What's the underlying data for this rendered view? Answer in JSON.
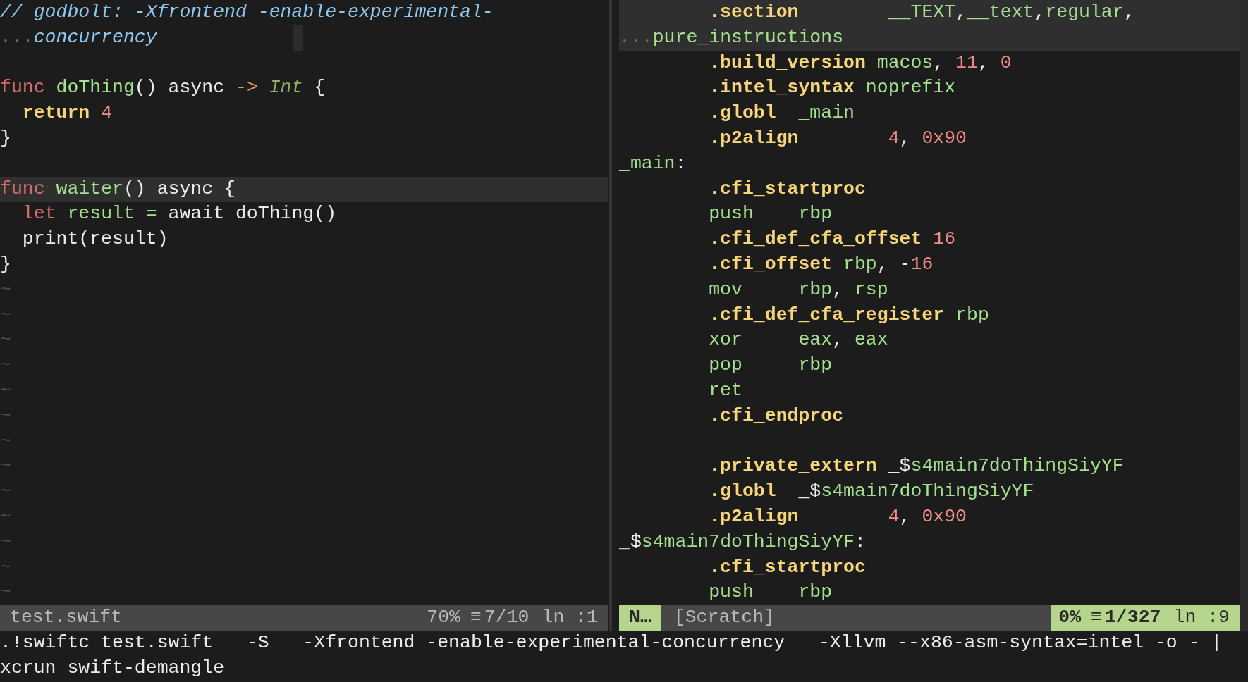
{
  "left_pane": {
    "lines": [
      {
        "kind": "code",
        "current": false,
        "tokens": [
          {
            "text": "// godbolt: -Xfrontend -enable-experimental-",
            "kind": "comment"
          }
        ]
      },
      {
        "kind": "code",
        "current": false,
        "cursor": true,
        "tokens": [
          {
            "text": "...",
            "kind": "wrap"
          },
          {
            "text": "concurrency",
            "kind": "comment"
          }
        ]
      },
      {
        "kind": "blank"
      },
      {
        "kind": "code",
        "current": false,
        "tokens": [
          {
            "text": "func",
            "kind": "keyword"
          },
          {
            "text": " doThing",
            "kind": "name"
          },
          {
            "text": "() async ",
            "kind": "plain"
          },
          {
            "text": "->",
            "kind": "operator"
          },
          {
            "text": " Int",
            "kind": "type"
          },
          {
            "text": " {",
            "kind": "plain"
          }
        ]
      },
      {
        "kind": "code",
        "current": false,
        "tokens": [
          {
            "text": "  return",
            "kind": "statement"
          },
          {
            "text": " 4",
            "kind": "number"
          }
        ]
      },
      {
        "kind": "code",
        "current": false,
        "tokens": [
          {
            "text": "}",
            "kind": "plain"
          }
        ]
      },
      {
        "kind": "blank"
      },
      {
        "kind": "code",
        "current": true,
        "tokens": [
          {
            "text": "func",
            "kind": "keyword"
          },
          {
            "text": " waiter",
            "kind": "name"
          },
          {
            "text": "() async {",
            "kind": "plain"
          }
        ]
      },
      {
        "kind": "code",
        "current": false,
        "tokens": [
          {
            "text": "  let",
            "kind": "keyword"
          },
          {
            "text": " result =",
            "kind": "name"
          },
          {
            "text": " await doThing()",
            "kind": "plain"
          }
        ]
      },
      {
        "kind": "code",
        "current": false,
        "tokens": [
          {
            "text": "  print(result)",
            "kind": "plain"
          }
        ]
      },
      {
        "kind": "code",
        "current": false,
        "tokens": [
          {
            "text": "}",
            "kind": "plain"
          }
        ]
      },
      {
        "kind": "filler",
        "text": "~"
      },
      {
        "kind": "filler",
        "text": "~"
      },
      {
        "kind": "filler",
        "text": "~"
      },
      {
        "kind": "filler",
        "text": "~"
      },
      {
        "kind": "filler",
        "text": "~"
      },
      {
        "kind": "filler",
        "text": "~"
      },
      {
        "kind": "filler",
        "text": "~"
      },
      {
        "kind": "filler",
        "text": "~"
      },
      {
        "kind": "filler",
        "text": "~"
      },
      {
        "kind": "filler",
        "text": "~"
      },
      {
        "kind": "filler",
        "text": "~"
      },
      {
        "kind": "filler",
        "text": "~"
      },
      {
        "kind": "filler",
        "text": "~"
      }
    ],
    "status_bar": {
      "active": false,
      "file": "test.swift",
      "percent": "70%",
      "lines_icon": "≡",
      "position": "7/10",
      "column": "ln :1"
    }
  },
  "right_pane": {
    "lines": [
      {
        "kind": "code",
        "current": true,
        "tokens": [
          {
            "text": "        .section",
            "kind": "directive"
          },
          {
            "text": "        __TEXT",
            "kind": "name"
          },
          {
            "text": ",",
            "kind": "plain"
          },
          {
            "text": "__text",
            "kind": "name"
          },
          {
            "text": ",",
            "kind": "plain"
          },
          {
            "text": "regular",
            "kind": "name"
          },
          {
            "text": ",",
            "kind": "plain"
          }
        ]
      },
      {
        "kind": "code",
        "current": true,
        "tokens": [
          {
            "text": "...",
            "kind": "wrap"
          },
          {
            "text": "pure_instructions",
            "kind": "name"
          }
        ]
      },
      {
        "kind": "code",
        "current": false,
        "tokens": [
          {
            "text": "        .build_version",
            "kind": "directive"
          },
          {
            "text": " macos",
            "kind": "name"
          },
          {
            "text": ", ",
            "kind": "plain"
          },
          {
            "text": "11",
            "kind": "number"
          },
          {
            "text": ", ",
            "kind": "plain"
          },
          {
            "text": "0",
            "kind": "number"
          }
        ]
      },
      {
        "kind": "code",
        "current": false,
        "tokens": [
          {
            "text": "        .intel_syntax",
            "kind": "directive"
          },
          {
            "text": " noprefix",
            "kind": "name"
          }
        ]
      },
      {
        "kind": "code",
        "current": false,
        "tokens": [
          {
            "text": "        .globl",
            "kind": "directive"
          },
          {
            "text": "  _main",
            "kind": "name"
          }
        ]
      },
      {
        "kind": "code",
        "current": false,
        "tokens": [
          {
            "text": "        .p2align",
            "kind": "directive"
          },
          {
            "text": "        4",
            "kind": "number"
          },
          {
            "text": ", ",
            "kind": "plain"
          },
          {
            "text": "0x90",
            "kind": "number"
          }
        ]
      },
      {
        "kind": "code",
        "current": false,
        "tokens": [
          {
            "text": "_main",
            "kind": "name"
          },
          {
            "text": ":",
            "kind": "plain"
          }
        ]
      },
      {
        "kind": "code",
        "current": false,
        "tokens": [
          {
            "text": "        .cfi_startproc",
            "kind": "directive"
          }
        ]
      },
      {
        "kind": "code",
        "current": false,
        "tokens": [
          {
            "text": "        push    rbp",
            "kind": "name"
          }
        ]
      },
      {
        "kind": "code",
        "current": false,
        "tokens": [
          {
            "text": "        .cfi_def_cfa_offset",
            "kind": "directive"
          },
          {
            "text": " 16",
            "kind": "number"
          }
        ]
      },
      {
        "kind": "code",
        "current": false,
        "tokens": [
          {
            "text": "        .cfi_offset",
            "kind": "directive"
          },
          {
            "text": " rbp",
            "kind": "name"
          },
          {
            "text": ", -",
            "kind": "plain"
          },
          {
            "text": "16",
            "kind": "number"
          }
        ]
      },
      {
        "kind": "code",
        "current": false,
        "tokens": [
          {
            "text": "        mov     rbp",
            "kind": "name"
          },
          {
            "text": ", ",
            "kind": "plain"
          },
          {
            "text": "rsp",
            "kind": "name"
          }
        ]
      },
      {
        "kind": "code",
        "current": false,
        "tokens": [
          {
            "text": "        .cfi_def_cfa_register",
            "kind": "directive"
          },
          {
            "text": " rbp",
            "kind": "name"
          }
        ]
      },
      {
        "kind": "code",
        "current": false,
        "tokens": [
          {
            "text": "        xor     eax",
            "kind": "name"
          },
          {
            "text": ", ",
            "kind": "plain"
          },
          {
            "text": "eax",
            "kind": "name"
          }
        ]
      },
      {
        "kind": "code",
        "current": false,
        "tokens": [
          {
            "text": "        pop     rbp",
            "kind": "name"
          }
        ]
      },
      {
        "kind": "code",
        "current": false,
        "tokens": [
          {
            "text": "        ret",
            "kind": "name"
          }
        ]
      },
      {
        "kind": "code",
        "current": false,
        "tokens": [
          {
            "text": "        .cfi_endproc",
            "kind": "directive"
          }
        ]
      },
      {
        "kind": "blank"
      },
      {
        "kind": "code",
        "current": false,
        "tokens": [
          {
            "text": "        .private_extern",
            "kind": "directive"
          },
          {
            "text": " _$",
            "kind": "plain"
          },
          {
            "text": "s4main7doThingSiyYF",
            "kind": "name"
          }
        ]
      },
      {
        "kind": "code",
        "current": false,
        "tokens": [
          {
            "text": "        .globl",
            "kind": "directive"
          },
          {
            "text": "  _$",
            "kind": "plain"
          },
          {
            "text": "s4main7doThingSiyYF",
            "kind": "name"
          }
        ]
      },
      {
        "kind": "code",
        "current": false,
        "tokens": [
          {
            "text": "        .p2align",
            "kind": "directive"
          },
          {
            "text": "        4",
            "kind": "number"
          },
          {
            "text": ", ",
            "kind": "plain"
          },
          {
            "text": "0x90",
            "kind": "number"
          }
        ]
      },
      {
        "kind": "code",
        "current": false,
        "tokens": [
          {
            "text": "_",
            "kind": "name"
          },
          {
            "text": "$",
            "kind": "plain"
          },
          {
            "text": "s4main7doThingSiyYF",
            "kind": "name"
          },
          {
            "text": ":",
            "kind": "plain"
          }
        ]
      },
      {
        "kind": "code",
        "current": false,
        "tokens": [
          {
            "text": "        .cfi_startproc",
            "kind": "directive"
          }
        ]
      },
      {
        "kind": "code",
        "current": false,
        "tokens": [
          {
            "text": "        push    rbp",
            "kind": "name"
          }
        ]
      }
    ],
    "status_bar": {
      "active": true,
      "mode": "N…",
      "file": "[Scratch]",
      "percent": "0%",
      "lines_icon": "≡",
      "position": "1/327",
      "column": "ln :9"
    }
  },
  "command_line": [
    ".!swiftc test.swift   -S   -Xfrontend -enable-experimental-concurrency   -Xllvm --x86-asm-syntax=intel -o - |",
    "xcrun swift-demangle"
  ]
}
